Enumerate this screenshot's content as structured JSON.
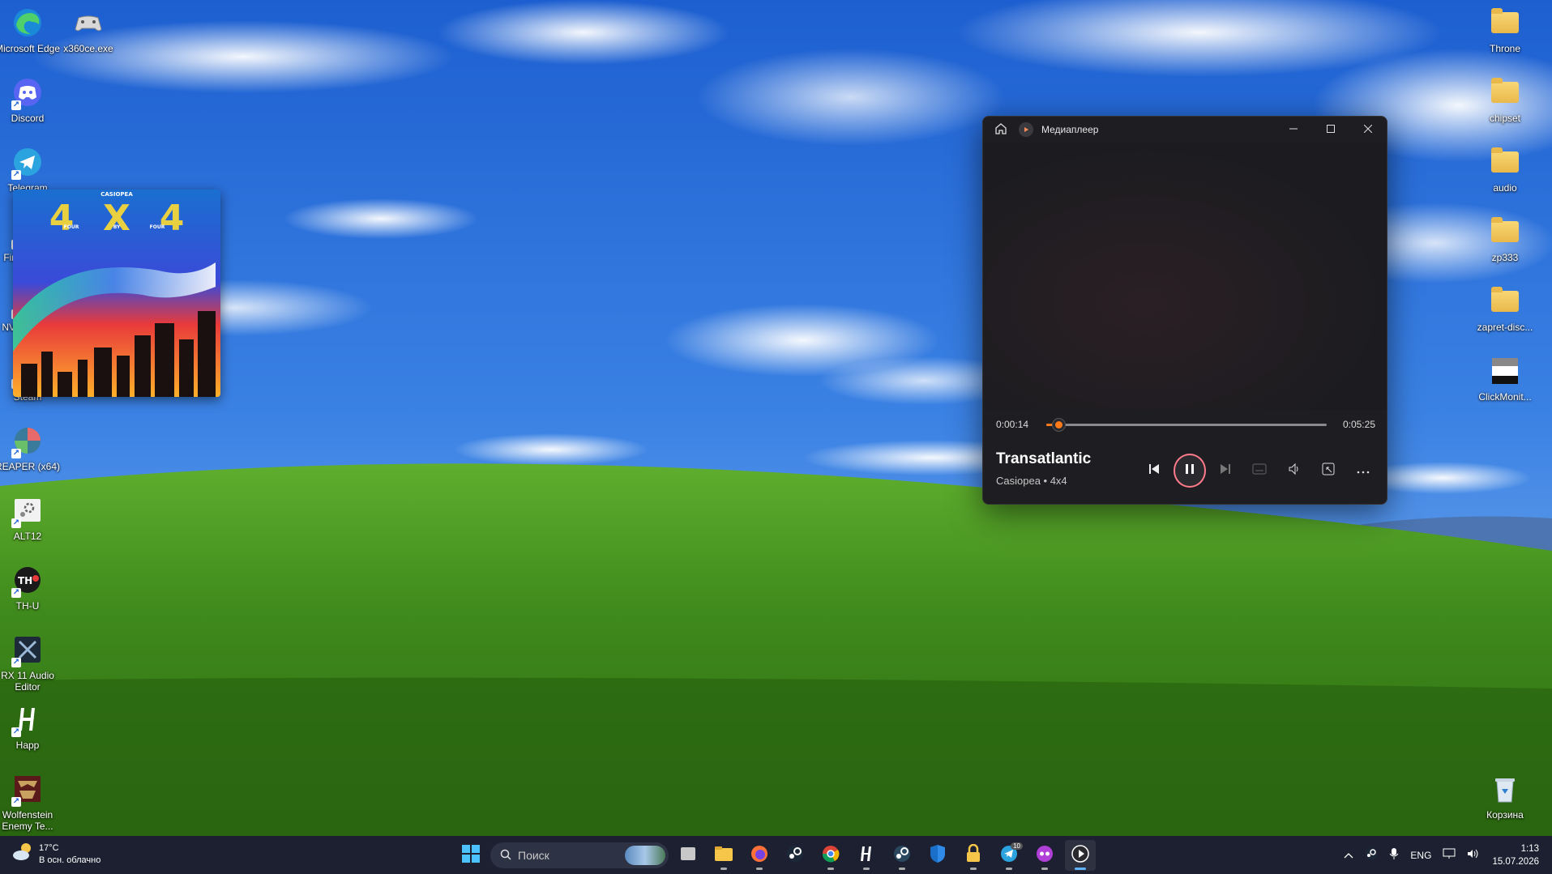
{
  "desktop": {
    "left_icons": [
      {
        "label": "Microsoft Edge",
        "icon": "edge-icon"
      },
      {
        "label": "Discord",
        "icon": "discord-icon"
      },
      {
        "label": "Telegram",
        "icon": "telegram-icon"
      },
      {
        "label": "Firefox.exe",
        "icon": "firefox-icon"
      },
      {
        "label": "NVIDIA App",
        "icon": "nvidia-icon"
      },
      {
        "label": "Steam",
        "icon": "steam-icon"
      },
      {
        "label": "REAPER (x64)",
        "icon": "reaper-icon"
      },
      {
        "label": "ALT12",
        "icon": "settings-icon"
      },
      {
        "label": "TH-U",
        "icon": "thu-icon"
      },
      {
        "label": "RX 11 Audio Editor",
        "icon": "rx-icon"
      },
      {
        "label": "Happ",
        "icon": "happ-icon"
      },
      {
        "label": "Wolfenstein Enemy Te...",
        "icon": "wolfenstein-icon"
      }
    ],
    "second_column": [
      {
        "label": "x360ce.exe",
        "icon": "gamepad-icon"
      }
    ],
    "right_icons": [
      {
        "label": "Throne",
        "icon": "folder-icon"
      },
      {
        "label": "chipset",
        "icon": "folder-icon"
      },
      {
        "label": "audio",
        "icon": "folder-icon"
      },
      {
        "label": "zp333",
        "icon": "folder-icon"
      },
      {
        "label": "zapret-disc...",
        "icon": "folder-icon"
      },
      {
        "label": "ClickMonit...",
        "icon": "monitor-icon"
      },
      {
        "label": "Корзина",
        "icon": "recycle-bin-icon"
      }
    ]
  },
  "player": {
    "title": "Медиаплеер",
    "album_art": {
      "brand": "CASIOPEA",
      "big": [
        "4",
        "X",
        "4"
      ],
      "small": [
        "FOUR",
        "BY",
        "FOUR"
      ]
    },
    "current_time": "0:00:14",
    "total_time": "0:05:25",
    "progress": 0.043,
    "song": "Transatlantic",
    "artist_album": "Casiopea • 4x4",
    "accent": "#ff7a1a"
  },
  "taskbar": {
    "weather": {
      "temp": "17°C",
      "desc": "В осн. облачно"
    },
    "search_placeholder": "Поиск",
    "lang": "ENG",
    "time": "1:13",
    "date": "15.07.2026",
    "telegram_badge": "10"
  }
}
